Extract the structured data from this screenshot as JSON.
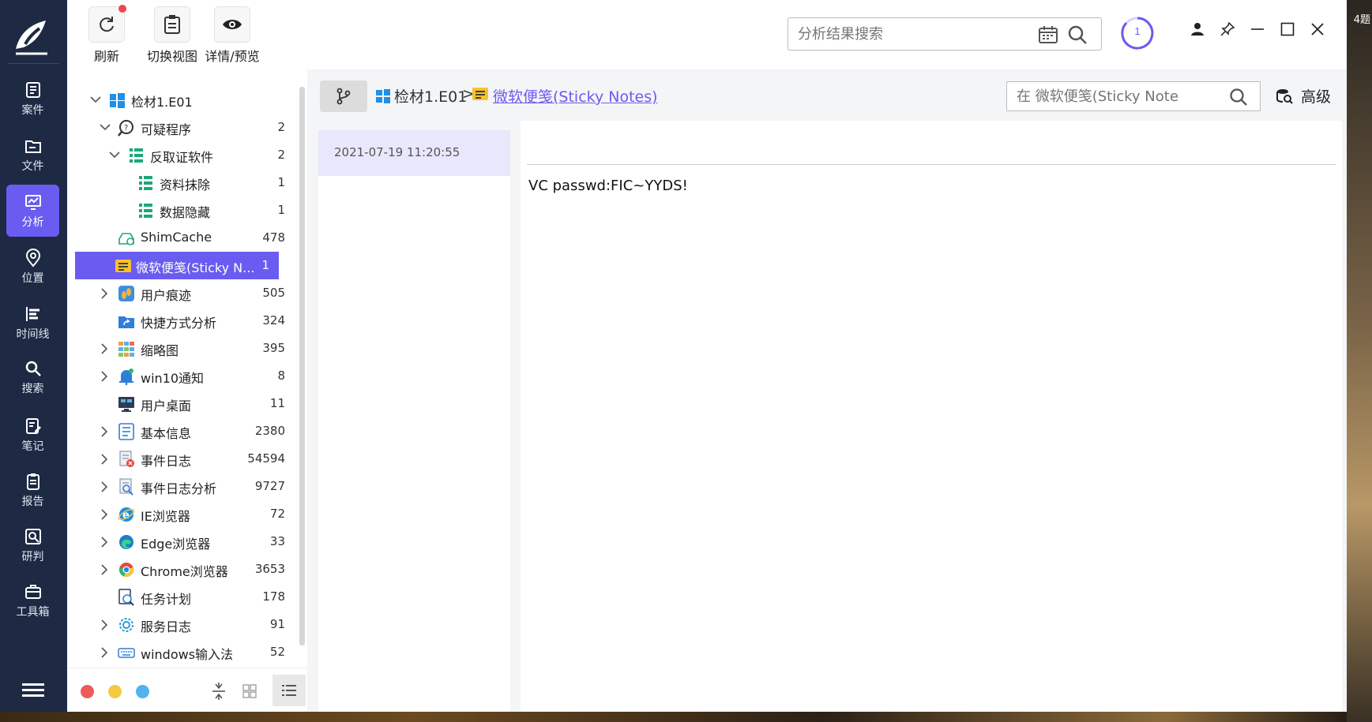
{
  "desktop": {
    "label": "4题"
  },
  "nav": {
    "items": [
      {
        "label": "案件",
        "icon": "case-icon"
      },
      {
        "label": "文件",
        "icon": "folder-icon"
      },
      {
        "label": "分析",
        "icon": "analysis-icon",
        "active": true
      },
      {
        "label": "位置",
        "icon": "location-icon"
      },
      {
        "label": "时间线",
        "icon": "timeline-icon"
      },
      {
        "label": "搜索",
        "icon": "search-icon"
      },
      {
        "label": "笔记",
        "icon": "notes-icon"
      },
      {
        "label": "报告",
        "icon": "report-icon"
      },
      {
        "label": "研判",
        "icon": "judge-icon"
      },
      {
        "label": "工具箱",
        "icon": "toolbox-icon"
      }
    ]
  },
  "toolbar": {
    "refresh_label": "刷新",
    "switch_view_label": "切换视图",
    "details_label": "详情/预览",
    "search_placeholder": "分析结果搜索",
    "task_count": "1"
  },
  "tree": {
    "items": [
      {
        "label": "检材1.E01",
        "count": ""
      },
      {
        "label": "可疑程序",
        "count": "2"
      },
      {
        "label": "反取证软件",
        "count": "2"
      },
      {
        "label": "资料抹除",
        "count": "1"
      },
      {
        "label": "数据隐藏",
        "count": "1"
      },
      {
        "label": "ShimCache",
        "count": "478"
      },
      {
        "label": "微软便笺(Sticky N...",
        "count": "1"
      },
      {
        "label": "用户痕迹",
        "count": "505"
      },
      {
        "label": "快捷方式分析",
        "count": "324"
      },
      {
        "label": "缩略图",
        "count": "395"
      },
      {
        "label": "win10通知",
        "count": "8"
      },
      {
        "label": "用户桌面",
        "count": "11"
      },
      {
        "label": "基本信息",
        "count": "2380"
      },
      {
        "label": "事件日志",
        "count": "54594"
      },
      {
        "label": "事件日志分析",
        "count": "9727"
      },
      {
        "label": "IE浏览器",
        "count": "72"
      },
      {
        "label": "Edge浏览器",
        "count": "33"
      },
      {
        "label": "Chrome浏览器",
        "count": "3653"
      },
      {
        "label": "任务计划",
        "count": "178"
      },
      {
        "label": "服务日志",
        "count": "91"
      },
      {
        "label": "windows输入法",
        "count": "52"
      }
    ],
    "colors": {
      "red": "#f0595a",
      "yellow": "#f5c842",
      "blue": "#4fb3f0"
    }
  },
  "breadcrumb": {
    "root": "检材1.E01",
    "separator": ">",
    "current": "微软便笺(Sticky Notes)"
  },
  "local_search": {
    "placeholder": "在 微软便笺(Sticky Note"
  },
  "advanced_label": "高级",
  "records": [
    {
      "timestamp": "2021-07-19 11:20:55"
    }
  ],
  "detail": {
    "content": "VC passwd:FIC~YYDS!"
  },
  "accent_color": "#6a5cf0"
}
